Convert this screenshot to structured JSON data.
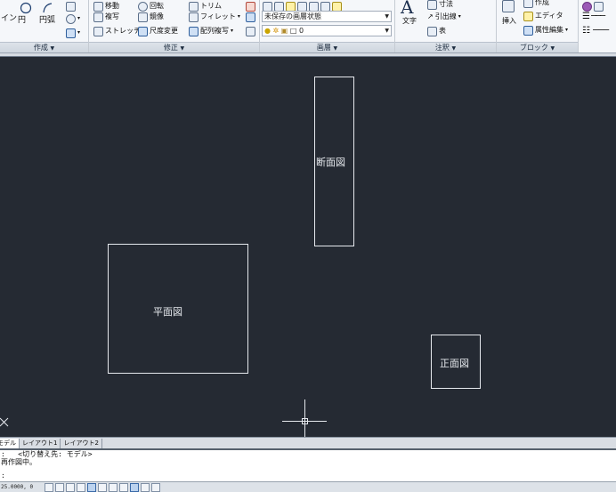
{
  "ribbon": {
    "panels": {
      "draw": "作成",
      "modify": "修正",
      "layers": "画層",
      "annotation": "注釈",
      "block": "ブロック"
    },
    "draw_tools": {
      "line": "イン",
      "circle": "円",
      "arc": "円弧"
    },
    "modify_tools": {
      "move": "移動",
      "rotate": "回転",
      "trim": "トリム",
      "copy": "複写",
      "mirror": "鏡像",
      "fillet": "フィレット",
      "stretch": "ストレッチ",
      "scale": "尺度変更",
      "array": "配列複写"
    },
    "layers": {
      "state_value": "未保存の画層状態",
      "current_layer": "0"
    },
    "annotation_tools": {
      "text": "文字",
      "dimension": "寸法",
      "leader": "引出線",
      "table": "表"
    },
    "block_tools": {
      "insert": "挿入",
      "create": "作成",
      "edit": "エディタ",
      "edit_attributes": "属性編集"
    }
  },
  "drawing": {
    "views": [
      {
        "id": "section",
        "label": "断面図"
      },
      {
        "id": "plan",
        "label": "平面図"
      },
      {
        "id": "front",
        "label": "正面図"
      }
    ],
    "colors": {
      "background": "#252a33",
      "lines": "#e6e9ee"
    }
  },
  "layout_tabs": [
    "モデル",
    "レイアウト1",
    "レイアウト2"
  ],
  "command_window": {
    "lines": [
      ":   <切り替え先: モデル>",
      "再作図中。",
      ":"
    ]
  },
  "status_bar": {
    "coordinates": "25.0000, 0"
  }
}
